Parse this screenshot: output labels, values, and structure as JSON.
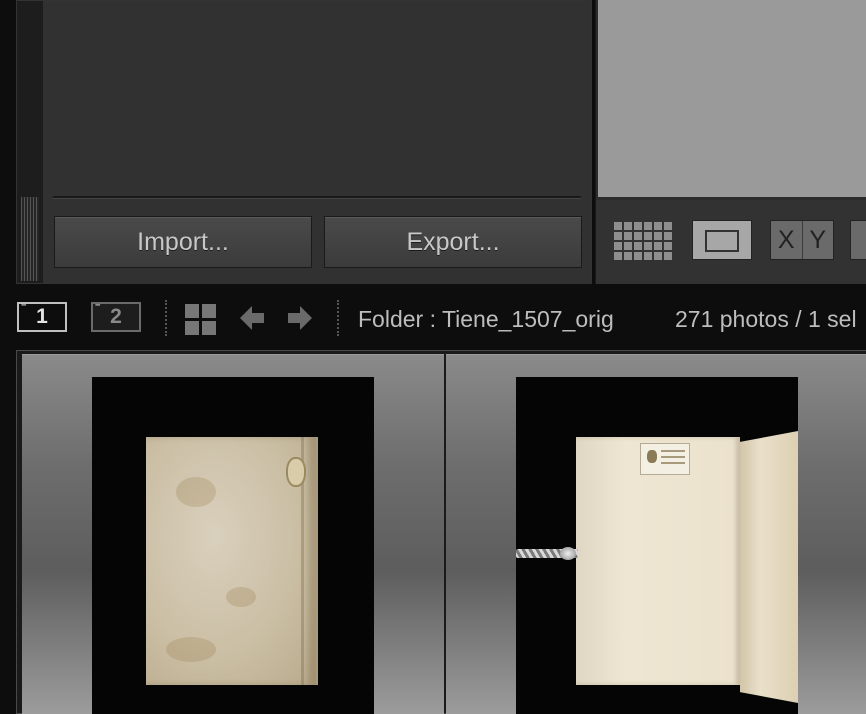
{
  "left_panel": {
    "import_label": "Import...",
    "export_label": "Export..."
  },
  "view_toolbar": {
    "grid_view_icon": "grid-view-icon",
    "loupe_view_icon": "loupe-view-icon",
    "compare_x_label": "X",
    "compare_y_label": "Y",
    "compare_icon": "compare-view-icon",
    "survey_icon": "survey-view-icon"
  },
  "nav_bar": {
    "screen_1_label": "1",
    "screen_2_label": "2",
    "folder_text": "Folder : Tiene_1507_orig",
    "count_text": "271 photos / 1 sel"
  },
  "thumbnails": [
    {
      "subject": "closed vellum book cover"
    },
    {
      "subject": "open book with bookplate and metal pointer"
    }
  ],
  "colors": {
    "panel_bg": "#313131",
    "preview_bg": "#9a9a9a",
    "text": "#bdbdbd",
    "button_text": "#c8c8c8"
  }
}
